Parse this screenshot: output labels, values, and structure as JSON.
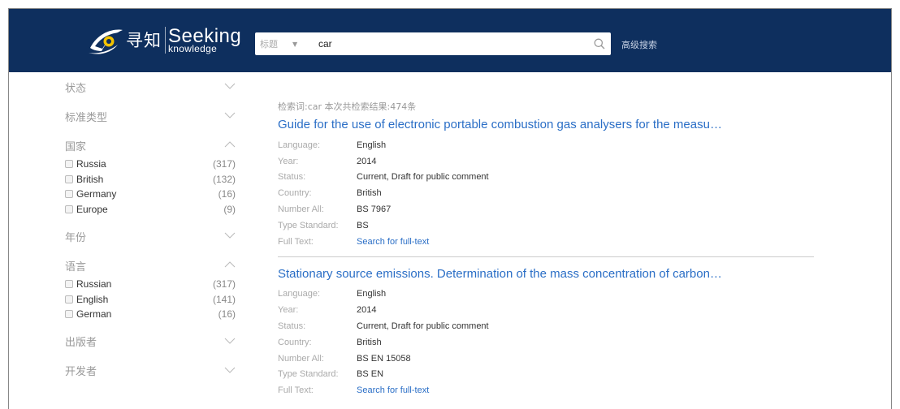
{
  "header": {
    "logo_cn": "寻知",
    "logo_en_big": "Seeking",
    "logo_en_small": "knowledge",
    "search_type": "标题",
    "search_value": "car",
    "advanced_search": "高级搜索"
  },
  "sidebar": {
    "facets": [
      {
        "title": "状态",
        "expanded": false,
        "items": []
      },
      {
        "title": "标准类型",
        "expanded": false,
        "items": []
      },
      {
        "title": "国家",
        "expanded": true,
        "items": [
          {
            "label": "Russia",
            "count": "(317)"
          },
          {
            "label": "British",
            "count": "(132)"
          },
          {
            "label": "Germany",
            "count": "(16)"
          },
          {
            "label": "Europe",
            "count": "(9)"
          }
        ]
      },
      {
        "title": "年份",
        "expanded": false,
        "items": []
      },
      {
        "title": "语言",
        "expanded": true,
        "items": [
          {
            "label": "Russian",
            "count": "(317)"
          },
          {
            "label": "English",
            "count": "(141)"
          },
          {
            "label": "German",
            "count": "(16)"
          }
        ]
      },
      {
        "title": "出版者",
        "expanded": false,
        "items": []
      },
      {
        "title": "开发者",
        "expanded": false,
        "items": []
      }
    ]
  },
  "results": {
    "summary": "检索词:car  本次共检索结果:474条",
    "items": [
      {
        "title": "Guide for the use of electronic portable combustion gas analysers for the measu…",
        "fields": [
          {
            "k": "Language:",
            "v": "English"
          },
          {
            "k": "Year:",
            "v": "2014"
          },
          {
            "k": "Status:",
            "v": "Current, Draft for public comment"
          },
          {
            "k": "Country:",
            "v": "British"
          },
          {
            "k": "Number All:",
            "v": "BS 7967"
          },
          {
            "k": "Type Standard:",
            "v": "BS"
          },
          {
            "k": "Full Text:",
            "v": "Search for full-text",
            "link": true
          }
        ]
      },
      {
        "title": "Stationary source emissions. Determination of the mass concentration of carbon…",
        "fields": [
          {
            "k": "Language:",
            "v": "English"
          },
          {
            "k": "Year:",
            "v": "2014"
          },
          {
            "k": "Status:",
            "v": "Current, Draft for public comment"
          },
          {
            "k": "Country:",
            "v": "British"
          },
          {
            "k": "Number All:",
            "v": "BS EN 15058"
          },
          {
            "k": "Type Standard:",
            "v": "BS EN"
          },
          {
            "k": "Full Text:",
            "v": "Search for full-text",
            "link": true
          }
        ]
      }
    ]
  },
  "colors": {
    "header_bg": "#0e2f5e",
    "link": "#2a6ec6",
    "logo_accent": "#f2c200"
  },
  "icons": [
    "logo-eye-icon",
    "search-icon",
    "chevron-down-icon",
    "chevron-up-icon",
    "checkbox-icon"
  ]
}
